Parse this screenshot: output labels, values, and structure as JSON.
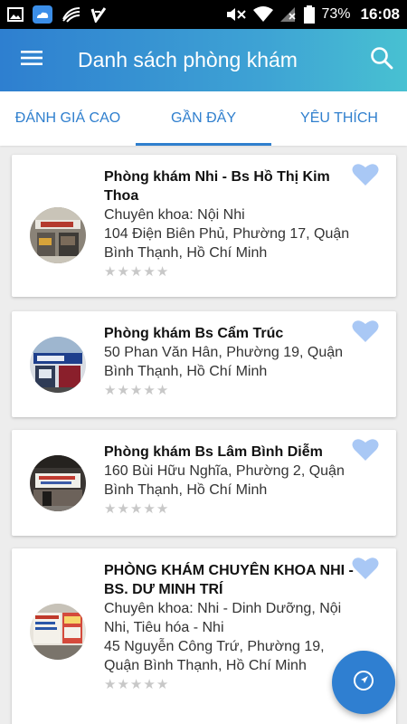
{
  "status_bar": {
    "battery": "73%",
    "time": "16:08",
    "icons": [
      "gallery-icon",
      "weather-icon",
      "swipe-icon",
      "check-icon",
      "mute-icon",
      "wifi-icon",
      "signal-icon",
      "battery-icon"
    ]
  },
  "header": {
    "title": "Danh sách phòng khám",
    "menu_icon": "hamburger-menu-icon",
    "search_icon": "search-icon"
  },
  "tabs": [
    {
      "label": "ĐÁNH GIÁ CAO",
      "active": false
    },
    {
      "label": "GẦN ĐÂY",
      "active": true
    },
    {
      "label": "YÊU THÍCH",
      "active": false
    }
  ],
  "clinics": [
    {
      "name": "Phòng khám Nhi - Bs Hồ Thị Kim Thoa",
      "specialty": "Chuyên khoa: Nội Nhi",
      "address": "104 Điện Biên Phủ, Phường 17, Quận Bình Thạnh, Hồ Chí Minh",
      "rating": 0
    },
    {
      "name": "Phòng khám Bs Cẩm Trúc",
      "specialty": "",
      "address": "50 Phan Văn Hân, Phường 19, Quận Bình Thạnh, Hồ Chí Minh",
      "rating": 0
    },
    {
      "name": "Phòng khám Bs Lâm Bình Diễm",
      "specialty": "",
      "address": "160 Bùi Hữu Nghĩa, Phường 2, Quận Bình Thạnh, Hồ Chí Minh",
      "rating": 0
    },
    {
      "name": "PHÒNG KHÁM CHUYÊN KHOA NHI - BS. DƯ MINH TRÍ",
      "specialty": "Chuyên khoa: Nhi - Dinh Dưỡng, Nội Nhi, Tiêu hóa - Nhi",
      "address": "45 Nguyễn Công Trứ, Phường 19, Quận Bình Thạnh, Hồ Chí Minh",
      "rating": 0
    }
  ],
  "colors": {
    "primary": "#2f7fce",
    "header_gradient_end": "#48c1d2",
    "favorite_heart": "#a9c8f5",
    "star_empty": "#c8c8c8"
  },
  "fab_icon": "navigation-arrow-icon"
}
